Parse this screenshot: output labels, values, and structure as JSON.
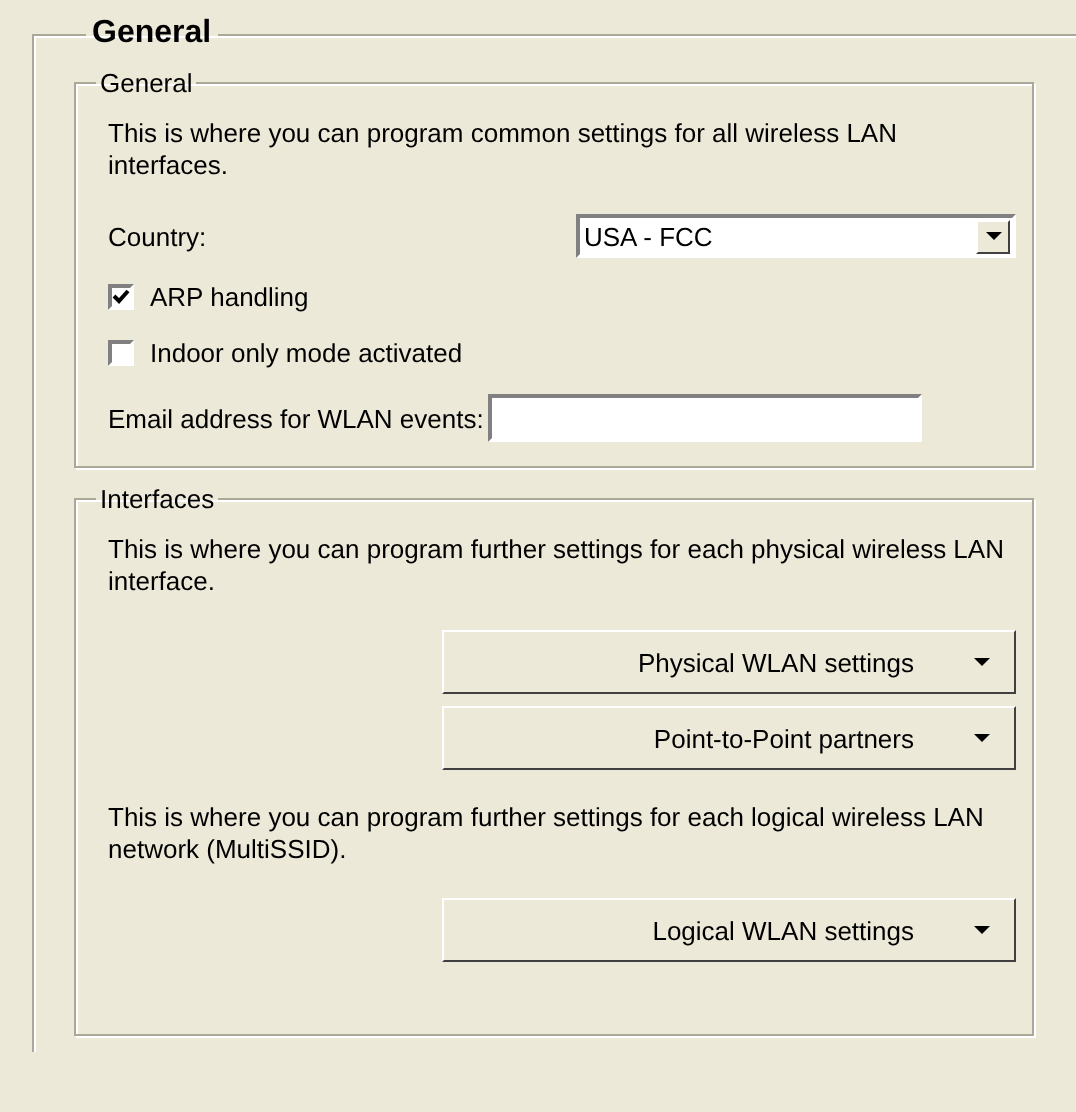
{
  "panel": {
    "title": "General"
  },
  "general": {
    "title": "General",
    "description": "This is where you can program common settings for all wireless LAN interfaces.",
    "country": {
      "label": "Country:",
      "value": "USA - FCC"
    },
    "options": [
      {
        "label": "ARP handling",
        "checked": true
      },
      {
        "label": "Indoor only mode activated",
        "checked": false
      }
    ],
    "email": {
      "label": "Email address for WLAN events:"
    }
  },
  "interfaces": {
    "title": "Interfaces",
    "sections": [
      {
        "description": "This is where you can program further settings for each physical wireless LAN interface.",
        "buttons": [
          "Physical WLAN settings",
          "Point-to-Point partners"
        ]
      },
      {
        "description": "This is where you can program further settings for each logical wireless LAN network (MultiSSID).",
        "buttons": [
          "Logical WLAN settings"
        ]
      }
    ]
  }
}
